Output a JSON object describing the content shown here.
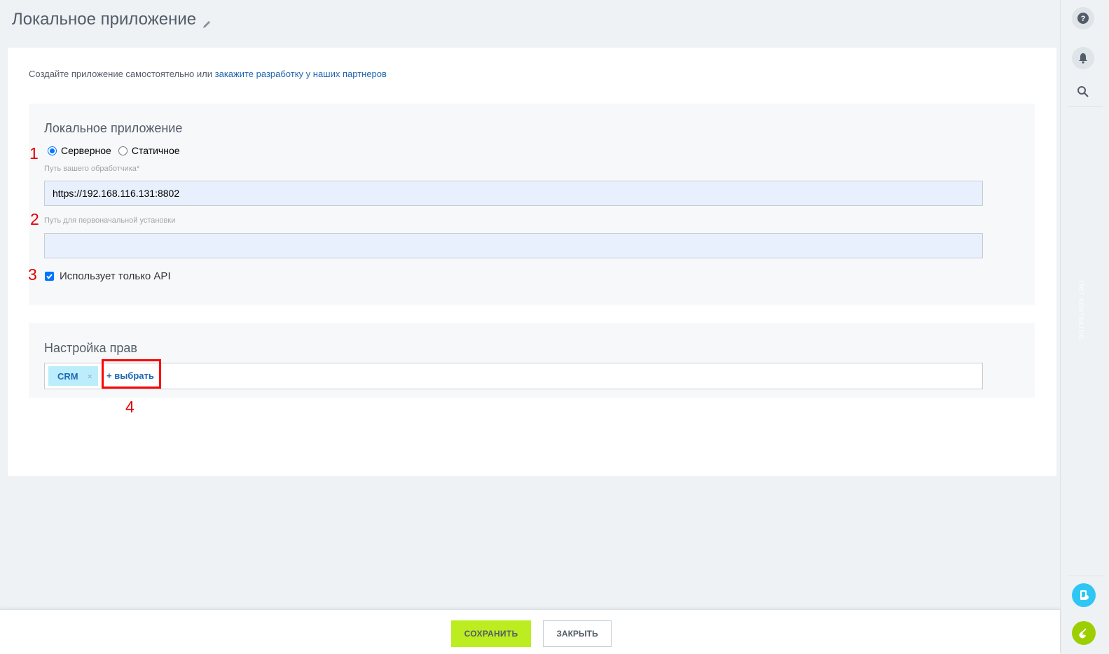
{
  "page": {
    "title": "Локальное приложение"
  },
  "intro": {
    "text": "Создайте приложение самостоятельно или ",
    "link": "закажите разработку у наших партнеров"
  },
  "app_section": {
    "title": "Локальное приложение",
    "radio_server": "Серверное",
    "radio_static": "Статичное",
    "selected": "Серверное",
    "handler_label": "Путь вашего обработчика*",
    "handler_value": "https://192.168.116.131:8802",
    "install_label": "Путь для первоначальной установки",
    "install_value": "",
    "api_only_label": "Использует только API",
    "api_only_checked": true
  },
  "rights_section": {
    "title": "Настройка прав",
    "tags": [
      "CRM"
    ],
    "tag_remove": "×",
    "select_label": "+ выбрать"
  },
  "annotations": [
    "1",
    "2",
    "3",
    "4"
  ],
  "right_panel": {
    "vertical_text": "Нет контактов",
    "icons": [
      "help-icon",
      "bell-icon",
      "search-icon",
      "phone-screen-icon",
      "phone-icon"
    ]
  },
  "footer": {
    "save_label": "СОХРАНИТЬ",
    "close_label": "ЗАКРЫТЬ"
  },
  "colors": {
    "accent_green": "#bbed21",
    "link_blue": "#2067b0",
    "annotation_red": "#ff0000",
    "tag_bg": "#bcedfc"
  }
}
